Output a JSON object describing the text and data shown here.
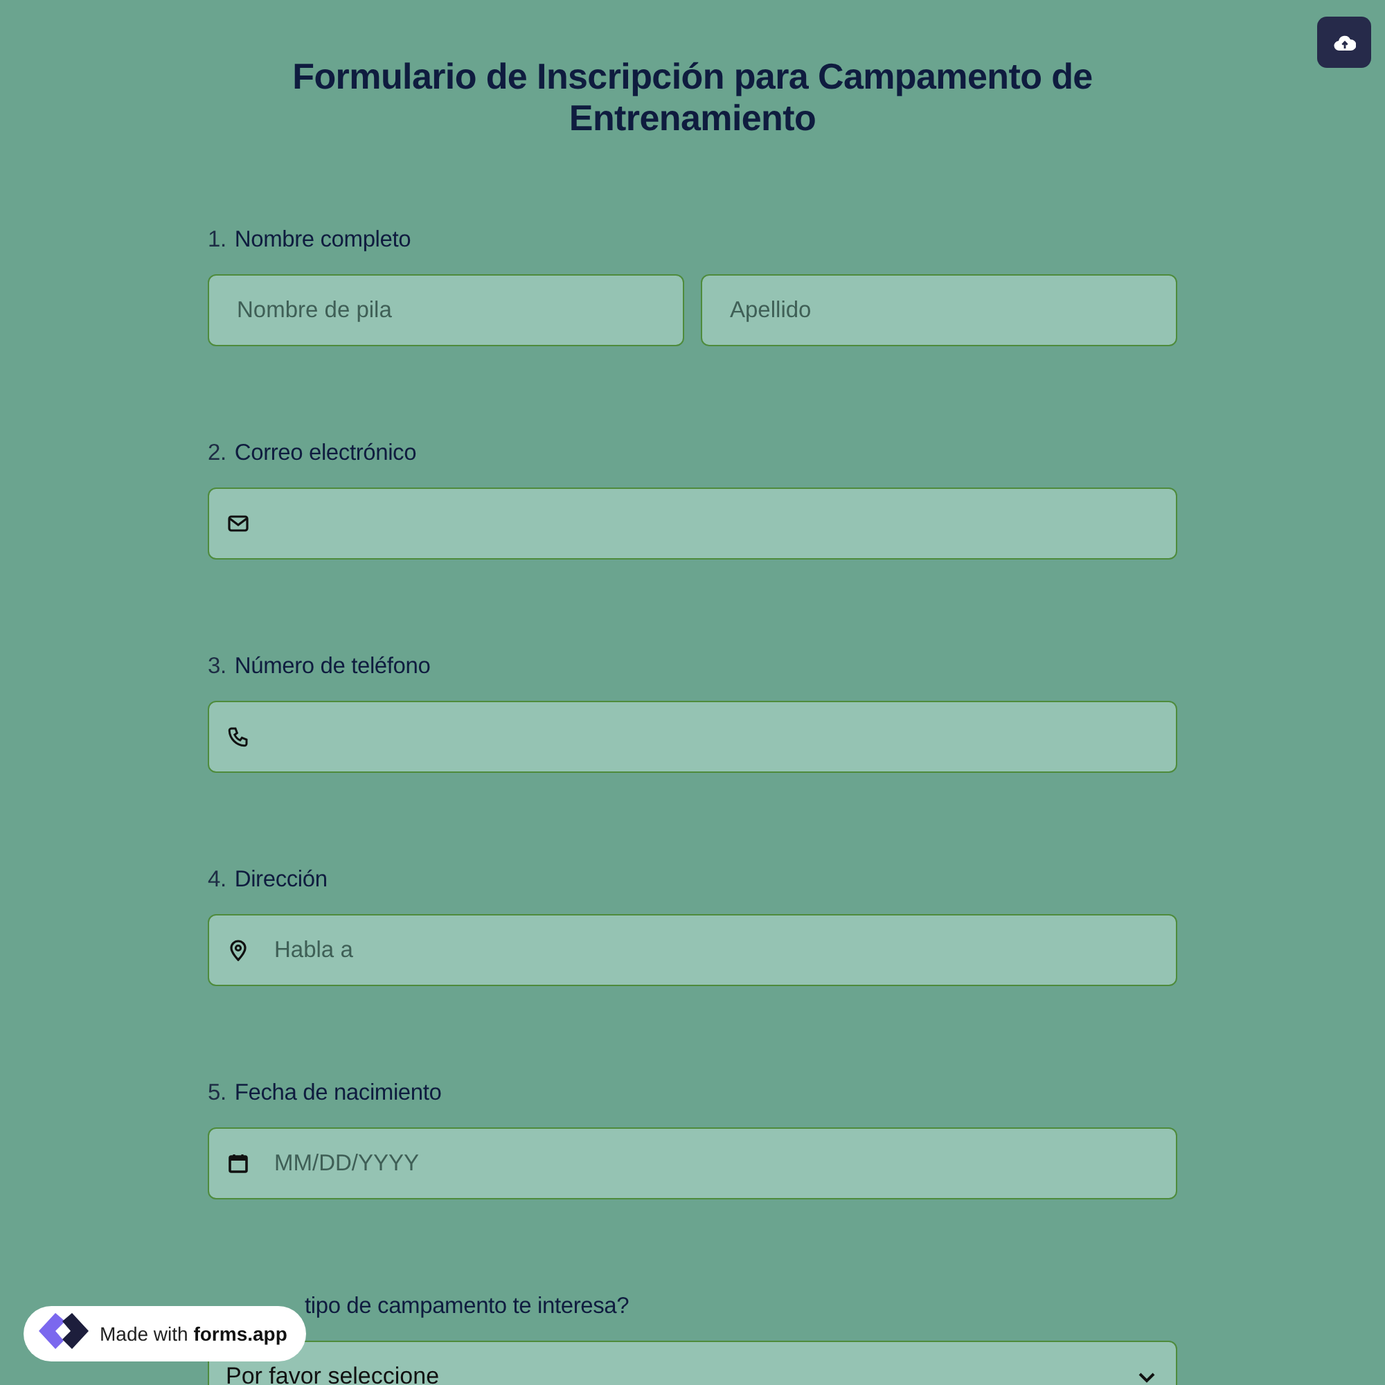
{
  "title": "Formulario de Inscripción para Campamento de Entrenamiento",
  "questions": [
    {
      "number": "1.",
      "label": "Nombre completo",
      "kind": "name",
      "fields": [
        {
          "placeholder": "Nombre de pila"
        },
        {
          "placeholder": "Apellido"
        }
      ]
    },
    {
      "number": "2.",
      "label": "Correo electrónico",
      "kind": "email"
    },
    {
      "number": "3.",
      "label": "Número de teléfono",
      "kind": "phone"
    },
    {
      "number": "4.",
      "label": "Dirección",
      "kind": "address",
      "placeholder": "Habla a"
    },
    {
      "number": "5.",
      "label": "Fecha de nacimiento",
      "kind": "date",
      "placeholder": "MM/DD/YYYY"
    },
    {
      "label": "tipo de campamento te interesa?",
      "kind": "select",
      "value": "Por favor seleccione"
    }
  ],
  "badge": {
    "prefix": "Made with",
    "brand": "forms.app"
  }
}
